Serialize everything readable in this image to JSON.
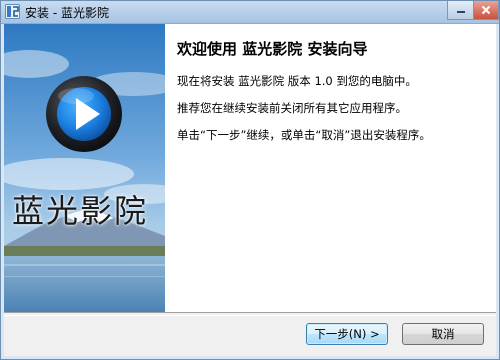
{
  "window": {
    "title": "安装 - 蓝光影院"
  },
  "side_image": {
    "brand_text": "蓝光影院",
    "play_icon": "play-logo-icon"
  },
  "content": {
    "heading": "欢迎使用 蓝光影院 安装向导",
    "paragraphs": [
      "现在将安装 蓝光影院 版本 1.0 到您的电脑中。",
      "推荐您在继续安装前关闭所有其它应用程序。",
      "单击“下一步”继续，或单击“取消”退出安装程序。"
    ]
  },
  "buttons": {
    "next_label": "下一步(N) >",
    "cancel_label": "取消"
  },
  "colors": {
    "accent": "#3c7fb1",
    "logo_blue": "#1b7fe0",
    "text": "#000000"
  }
}
